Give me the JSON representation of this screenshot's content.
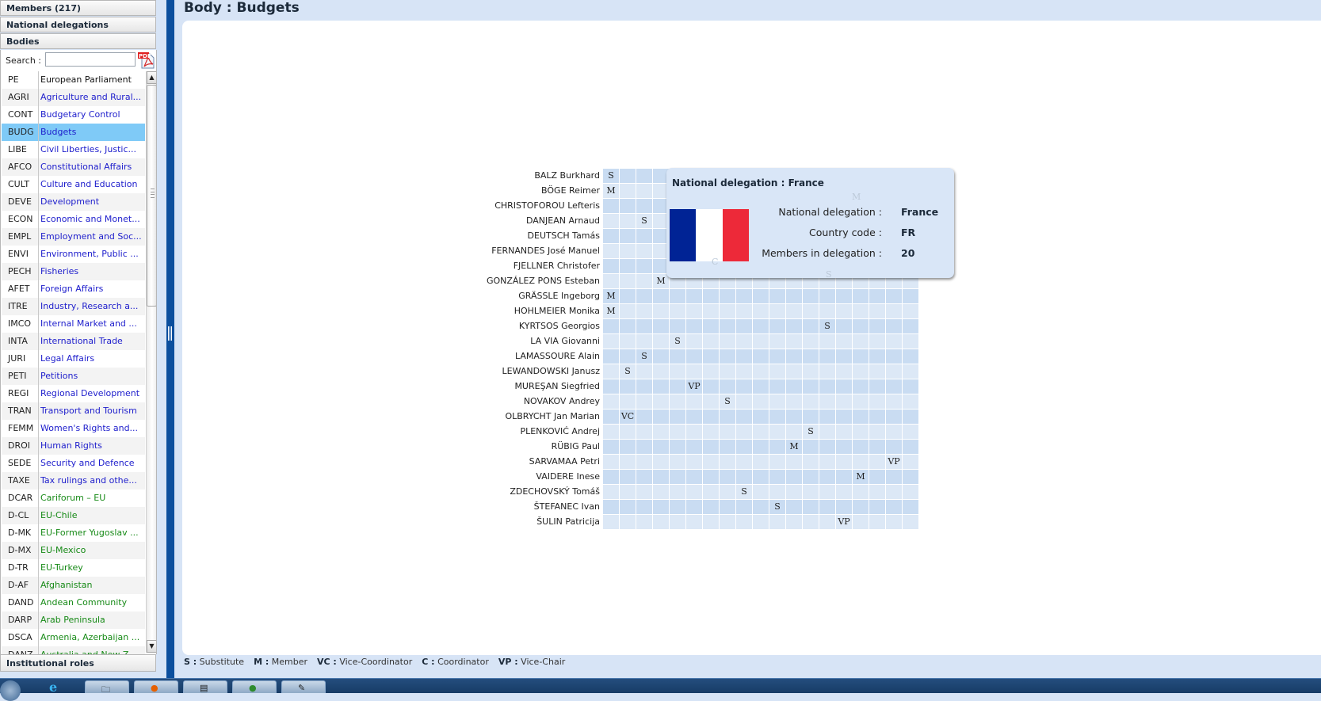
{
  "sidebar": {
    "sections": {
      "members": "Members (217)",
      "national_delegations": "National delegations",
      "bodies": "Bodies",
      "institutional_roles": "Institutional roles"
    },
    "search": {
      "label": "Search :",
      "value": "",
      "placeholder": ""
    },
    "pdf_icon_label": "PDF",
    "selected_code": "BUDG",
    "items": [
      {
        "code": "PE",
        "name": "European Parliament",
        "type": "plain"
      },
      {
        "code": "AGRI",
        "name": "Agriculture and Rural...",
        "type": "committee"
      },
      {
        "code": "CONT",
        "name": "Budgetary Control",
        "type": "committee"
      },
      {
        "code": "BUDG",
        "name": "Budgets",
        "type": "committee"
      },
      {
        "code": "LIBE",
        "name": "Civil Liberties, Justic...",
        "type": "committee"
      },
      {
        "code": "AFCO",
        "name": "Constitutional Affairs",
        "type": "committee"
      },
      {
        "code": "CULT",
        "name": "Culture and Education",
        "type": "committee"
      },
      {
        "code": "DEVE",
        "name": "Development",
        "type": "committee"
      },
      {
        "code": "ECON",
        "name": "Economic and Monet...",
        "type": "committee"
      },
      {
        "code": "EMPL",
        "name": "Employment and Soc...",
        "type": "committee"
      },
      {
        "code": "ENVI",
        "name": "Environment, Public ...",
        "type": "committee"
      },
      {
        "code": "PECH",
        "name": "Fisheries",
        "type": "committee"
      },
      {
        "code": "AFET",
        "name": "Foreign Affairs",
        "type": "committee"
      },
      {
        "code": "ITRE",
        "name": "Industry, Research a...",
        "type": "committee"
      },
      {
        "code": "IMCO",
        "name": "Internal Market and ...",
        "type": "committee"
      },
      {
        "code": "INTA",
        "name": "International Trade",
        "type": "committee"
      },
      {
        "code": "JURI",
        "name": "Legal Affairs",
        "type": "committee"
      },
      {
        "code": "PETI",
        "name": "Petitions",
        "type": "committee"
      },
      {
        "code": "REGI",
        "name": "Regional Development",
        "type": "committee"
      },
      {
        "code": "TRAN",
        "name": "Transport and Tourism",
        "type": "committee"
      },
      {
        "code": "FEMM",
        "name": "Women's Rights and...",
        "type": "committee"
      },
      {
        "code": "DROI",
        "name": "Human Rights",
        "type": "committee"
      },
      {
        "code": "SEDE",
        "name": "Security and Defence",
        "type": "committee"
      },
      {
        "code": "TAXE",
        "name": "Tax rulings and othe...",
        "type": "committee"
      },
      {
        "code": "DCAR",
        "name": "Cariforum – EU",
        "type": "delegation"
      },
      {
        "code": "D-CL",
        "name": "EU-Chile",
        "type": "delegation"
      },
      {
        "code": "D-MK",
        "name": "EU-Former Yugoslav ...",
        "type": "delegation"
      },
      {
        "code": "D-MX",
        "name": "EU-Mexico",
        "type": "delegation"
      },
      {
        "code": "D-TR",
        "name": "EU-Turkey",
        "type": "delegation"
      },
      {
        "code": "D-AF",
        "name": "Afghanistan",
        "type": "delegation"
      },
      {
        "code": "DAND",
        "name": "Andean Community",
        "type": "delegation"
      },
      {
        "code": "DARP",
        "name": "Arab Peninsula",
        "type": "delegation"
      },
      {
        "code": "DSCA",
        "name": "Armenia, Azerbaijan ...",
        "type": "delegation"
      },
      {
        "code": "DANZ",
        "name": "Australia and New Z...",
        "type": "delegation"
      }
    ]
  },
  "main": {
    "title": "Body : Budgets",
    "grid_columns": 19,
    "members": [
      {
        "name": "BALZ Burkhard",
        "role": "S",
        "col": 0
      },
      {
        "name": "BÖGE Reimer",
        "role": "M",
        "col": 0
      },
      {
        "name": "CHRISTOFOROU Lefteris",
        "role": "M",
        "col": 18
      },
      {
        "name": "DANJEAN Arnaud",
        "role": "S",
        "col": 2
      },
      {
        "name": "DEUTSCH Tamás",
        "role": "C",
        "col": 9
      },
      {
        "name": "FERNANDES José Manuel",
        "role": "",
        "col": null
      },
      {
        "name": "FJELLNER Christofer",
        "role": "S",
        "col": 7
      },
      {
        "name": "GONZÁLEZ PONS Esteban",
        "role": "M",
        "col": 3
      },
      {
        "name": "GRÄSSLE Ingeborg",
        "role": "M",
        "col": 0
      },
      {
        "name": "HOHLMEIER Monika",
        "role": "M",
        "col": 0
      },
      {
        "name": "KYRTSOS Georgios",
        "role": "S",
        "col": 13
      },
      {
        "name": "LA VIA Giovanni",
        "role": "S",
        "col": 4
      },
      {
        "name": "LAMASSOURE Alain",
        "role": "S",
        "col": 2
      },
      {
        "name": "LEWANDOWSKI Janusz",
        "role": "S",
        "col": 1
      },
      {
        "name": "MUREŞAN Siegfried",
        "role": "VP",
        "col": 5
      },
      {
        "name": "NOVAKOV Andrey",
        "role": "S",
        "col": 7
      },
      {
        "name": "OLBRYCHT Jan Marian",
        "role": "VC",
        "col": 1
      },
      {
        "name": "PLENKOVIĆ Andrej",
        "role": "S",
        "col": 12
      },
      {
        "name": "RÜBIG Paul",
        "role": "M",
        "col": 11
      },
      {
        "name": "SARVAMAA Petri",
        "role": "VP",
        "col": 17
      },
      {
        "name": "VAIDERE Inese",
        "role": "M",
        "col": 15
      },
      {
        "name": "ZDECHOVSKÝ Tomáš",
        "role": "S",
        "col": 8
      },
      {
        "name": "ŠTEFANEC Ivan",
        "role": "S",
        "col": 10
      },
      {
        "name": "ŠULIN Patricija",
        "role": "VP",
        "col": 14
      }
    ],
    "legend": [
      {
        "key": "S :",
        "label": "Substitute"
      },
      {
        "key": "M :",
        "label": "Member"
      },
      {
        "key": "VC :",
        "label": "Vice-Coordinator"
      },
      {
        "key": "C :",
        "label": "Coordinator"
      },
      {
        "key": "VP :",
        "label": "Vice-Chair"
      }
    ]
  },
  "tooltip": {
    "title": "National delegation : France",
    "flag_colors": [
      "#002395",
      "#ffffff",
      "#ed2939"
    ],
    "fields": [
      {
        "label": "National delegation :",
        "value": "France"
      },
      {
        "label": "Country code :",
        "value": "FR"
      },
      {
        "label": "Members in delegation :",
        "value": "20"
      }
    ]
  },
  "colors": {
    "accent_blue": "#0b4f9e",
    "selected_row": "#7fcaf7",
    "committee_link": "#1d1dcc",
    "delegation_link": "#178a17",
    "cell_dark": "#c9dcf2",
    "cell_light": "#dce8f6"
  },
  "taskbar": {
    "apps": [
      "start-orb",
      "internet-explorer",
      "file-explorer",
      "firefox",
      "notepad",
      "frog-app",
      "paint"
    ]
  }
}
